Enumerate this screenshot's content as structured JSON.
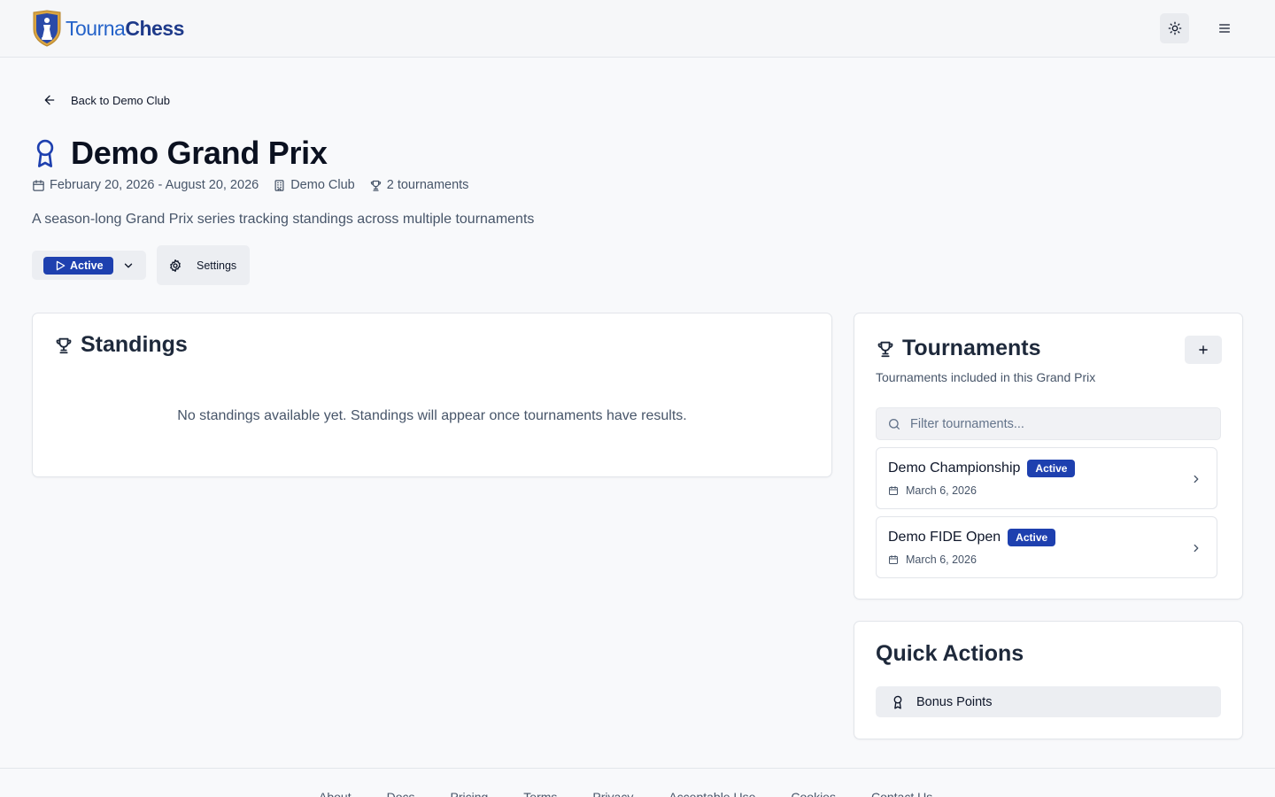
{
  "header": {
    "logo": {
      "part1": "Tourna",
      "part2": "Chess"
    }
  },
  "back": {
    "label": "Back to Demo Club"
  },
  "page": {
    "title": "Demo Grand Prix",
    "dates": "February 20, 2026 - August 20, 2026",
    "club": "Demo Club",
    "tournament_count": "2 tournaments",
    "description": "A season-long Grand Prix series tracking standings across multiple tournaments"
  },
  "status": {
    "label": "Active"
  },
  "settings": {
    "label": "Settings"
  },
  "standings": {
    "title": "Standings",
    "empty_message": "No standings available yet. Standings will appear once tournaments have results."
  },
  "tournaments": {
    "title": "Tournaments",
    "subtitle": "Tournaments included in this Grand Prix",
    "filter_placeholder": "Filter tournaments...",
    "filter_value": "",
    "items": [
      {
        "name": "Demo Championship",
        "status": "Active",
        "date": "March 6, 2026"
      },
      {
        "name": "Demo FIDE Open",
        "status": "Active",
        "date": "March 6, 2026"
      }
    ]
  },
  "quick_actions": {
    "title": "Quick Actions",
    "bonus_label": "Bonus Points"
  },
  "footer": {
    "links": [
      "About",
      "Docs",
      "Pricing",
      "Terms",
      "Privacy",
      "Acceptable Use",
      "Cookies",
      "Contact Us"
    ]
  },
  "colors": {
    "accent": "#1e40af",
    "logo_light": "#2563c9",
    "logo_dark": "#1e3a8a",
    "text_muted": "#475569"
  }
}
